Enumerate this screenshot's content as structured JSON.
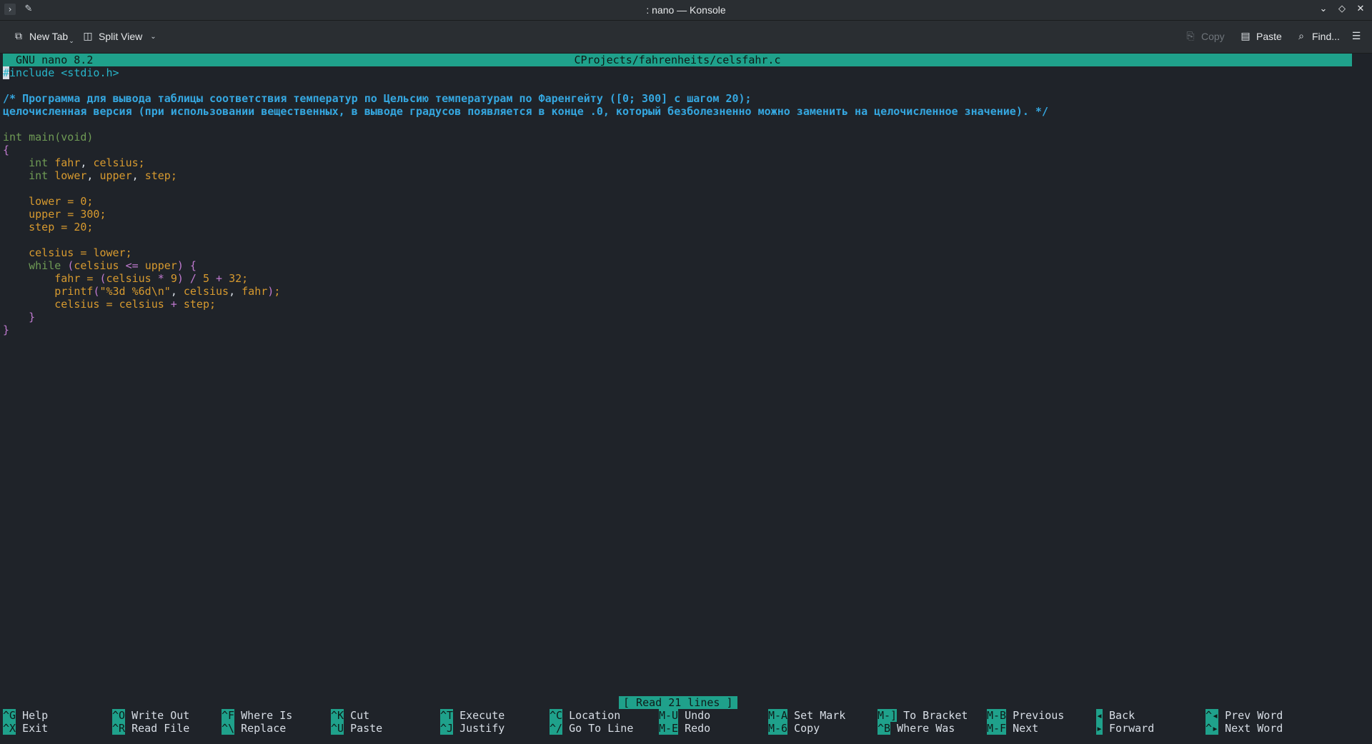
{
  "window": {
    "title": ": nano — Konsole"
  },
  "toolbar": {
    "new_tab": "New Tab",
    "split_view": "Split View",
    "copy": "Copy",
    "paste": "Paste",
    "find": "Find..."
  },
  "nano": {
    "version": "GNU nano 8.2",
    "filename": "CProjects/fahrenheits/celsfahr.c",
    "status": "[ Read 21 lines ]"
  },
  "code": {
    "l1_a": "#",
    "l1_b": "include",
    "l1_c": " <stdio.h>",
    "c1": "/* Программа для вывода таблицы соответствия температур по Цельсию температурам по Фаренгейту ([0; 300] с шагом 20);",
    "c2": "целочисленная версия (при использовании вещественных, в выводе градусов появляется в конце .0, который безболезненно можно заменить на целочисленное значение). */",
    "int": "int",
    "main": " main",
    "void": "void",
    "lp": "(",
    "rp": ")",
    "lbrace": "{",
    "rbrace": "}",
    "fahr": "fahr",
    "celsius": "celsius",
    "lower": "lower",
    "upper": "upper",
    "step": "step",
    "comma": ", ",
    "semi": ";",
    "eq": " = ",
    "zero": "0",
    "three_hundred": "300",
    "twenty": "20",
    "while": "while",
    "le": " <= ",
    "times": " * ",
    "nine": "9",
    "div": " / ",
    "five": "5",
    "plus": " + ",
    "thirty_two": "32",
    "printf": "printf",
    "fmt": "\"%3d %6d\\n\"",
    "indent1": "    ",
    "indent2": "        "
  },
  "shortcuts": [
    {
      "key": "^G",
      "label": "Help"
    },
    {
      "key": "^X",
      "label": "Exit"
    },
    {
      "key": "^O",
      "label": "Write Out"
    },
    {
      "key": "^R",
      "label": "Read File"
    },
    {
      "key": "^F",
      "label": "Where Is"
    },
    {
      "key": "^\\",
      "label": "Replace"
    },
    {
      "key": "^K",
      "label": "Cut"
    },
    {
      "key": "^U",
      "label": "Paste"
    },
    {
      "key": "^T",
      "label": "Execute"
    },
    {
      "key": "^J",
      "label": "Justify"
    },
    {
      "key": "^C",
      "label": "Location"
    },
    {
      "key": "^/",
      "label": "Go To Line"
    },
    {
      "key": "M-U",
      "label": "Undo"
    },
    {
      "key": "M-E",
      "label": "Redo"
    },
    {
      "key": "M-A",
      "label": "Set Mark"
    },
    {
      "key": "M-6",
      "label": "Copy"
    },
    {
      "key": "M-]",
      "label": "To Bracket"
    },
    {
      "key": "^B",
      "label": "Where Was"
    },
    {
      "key": "M-B",
      "label": "Previous"
    },
    {
      "key": "M-F",
      "label": "Next"
    },
    {
      "key": "◂",
      "label": "Back"
    },
    {
      "key": "▸",
      "label": "Forward"
    },
    {
      "key": "^◂",
      "label": "Prev Word"
    },
    {
      "key": "^▸",
      "label": "Next Word"
    }
  ],
  "colors": {
    "header_bg": "#1fa18b",
    "terminal_bg": "#1f2329",
    "comment": "#35a7e0"
  }
}
